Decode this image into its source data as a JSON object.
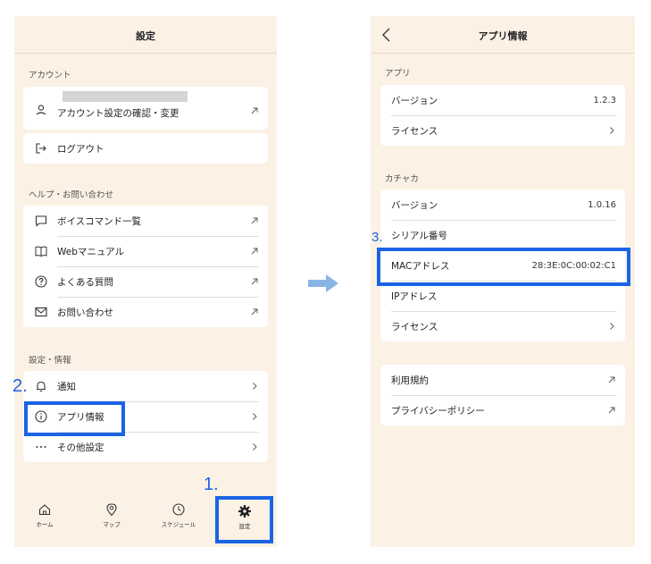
{
  "colors": {
    "screen_bg": "#fbf1e5",
    "highlight": "#1a64e6",
    "arrow": "#8ab4e6"
  },
  "settings_screen": {
    "title": "設定",
    "account_section": "アカウント",
    "account_settings_label": "アカウント設定の確認・変更",
    "logout_label": "ログアウト",
    "help_section": "ヘルプ・お問い合わせ",
    "help_items": [
      {
        "label": "ボイスコマンド一覧",
        "icon": "chat-bubble-icon"
      },
      {
        "label": "Webマニュアル",
        "icon": "book-icon"
      },
      {
        "label": "よくある質問",
        "icon": "question-circle-icon"
      },
      {
        "label": "お問い合わせ",
        "icon": "mail-icon"
      }
    ],
    "settings_section": "設定・情報",
    "notification_label": "通知",
    "app_info_label": "アプリ情報",
    "other_settings_label": "その他設定",
    "tabs": [
      {
        "label": "ホーム",
        "icon": "home-icon"
      },
      {
        "label": "マップ",
        "icon": "map-pin-icon"
      },
      {
        "label": "スケジュール",
        "icon": "clock-icon"
      },
      {
        "label": "設定",
        "icon": "gear-icon"
      }
    ]
  },
  "app_info_screen": {
    "title": "アプリ情報",
    "app_section": "アプリ",
    "app_version_label": "バージョン",
    "app_version": "1.2.3",
    "app_license_label": "ライセンス",
    "device_section": "カチャカ",
    "device_version_label": "バージョン",
    "device_version": "1.0.16",
    "serial_label": "シリアル番号",
    "mac_label": "MACアドレス",
    "mac_value": "28:3E:0C:00:02:C1",
    "ip_label": "IPアドレス",
    "device_license_label": "ライセンス",
    "terms_label": "利用規約",
    "privacy_label": "プライバシーポリシー"
  },
  "steps": {
    "step1": "1.",
    "step2": "2.",
    "step3": "3."
  }
}
